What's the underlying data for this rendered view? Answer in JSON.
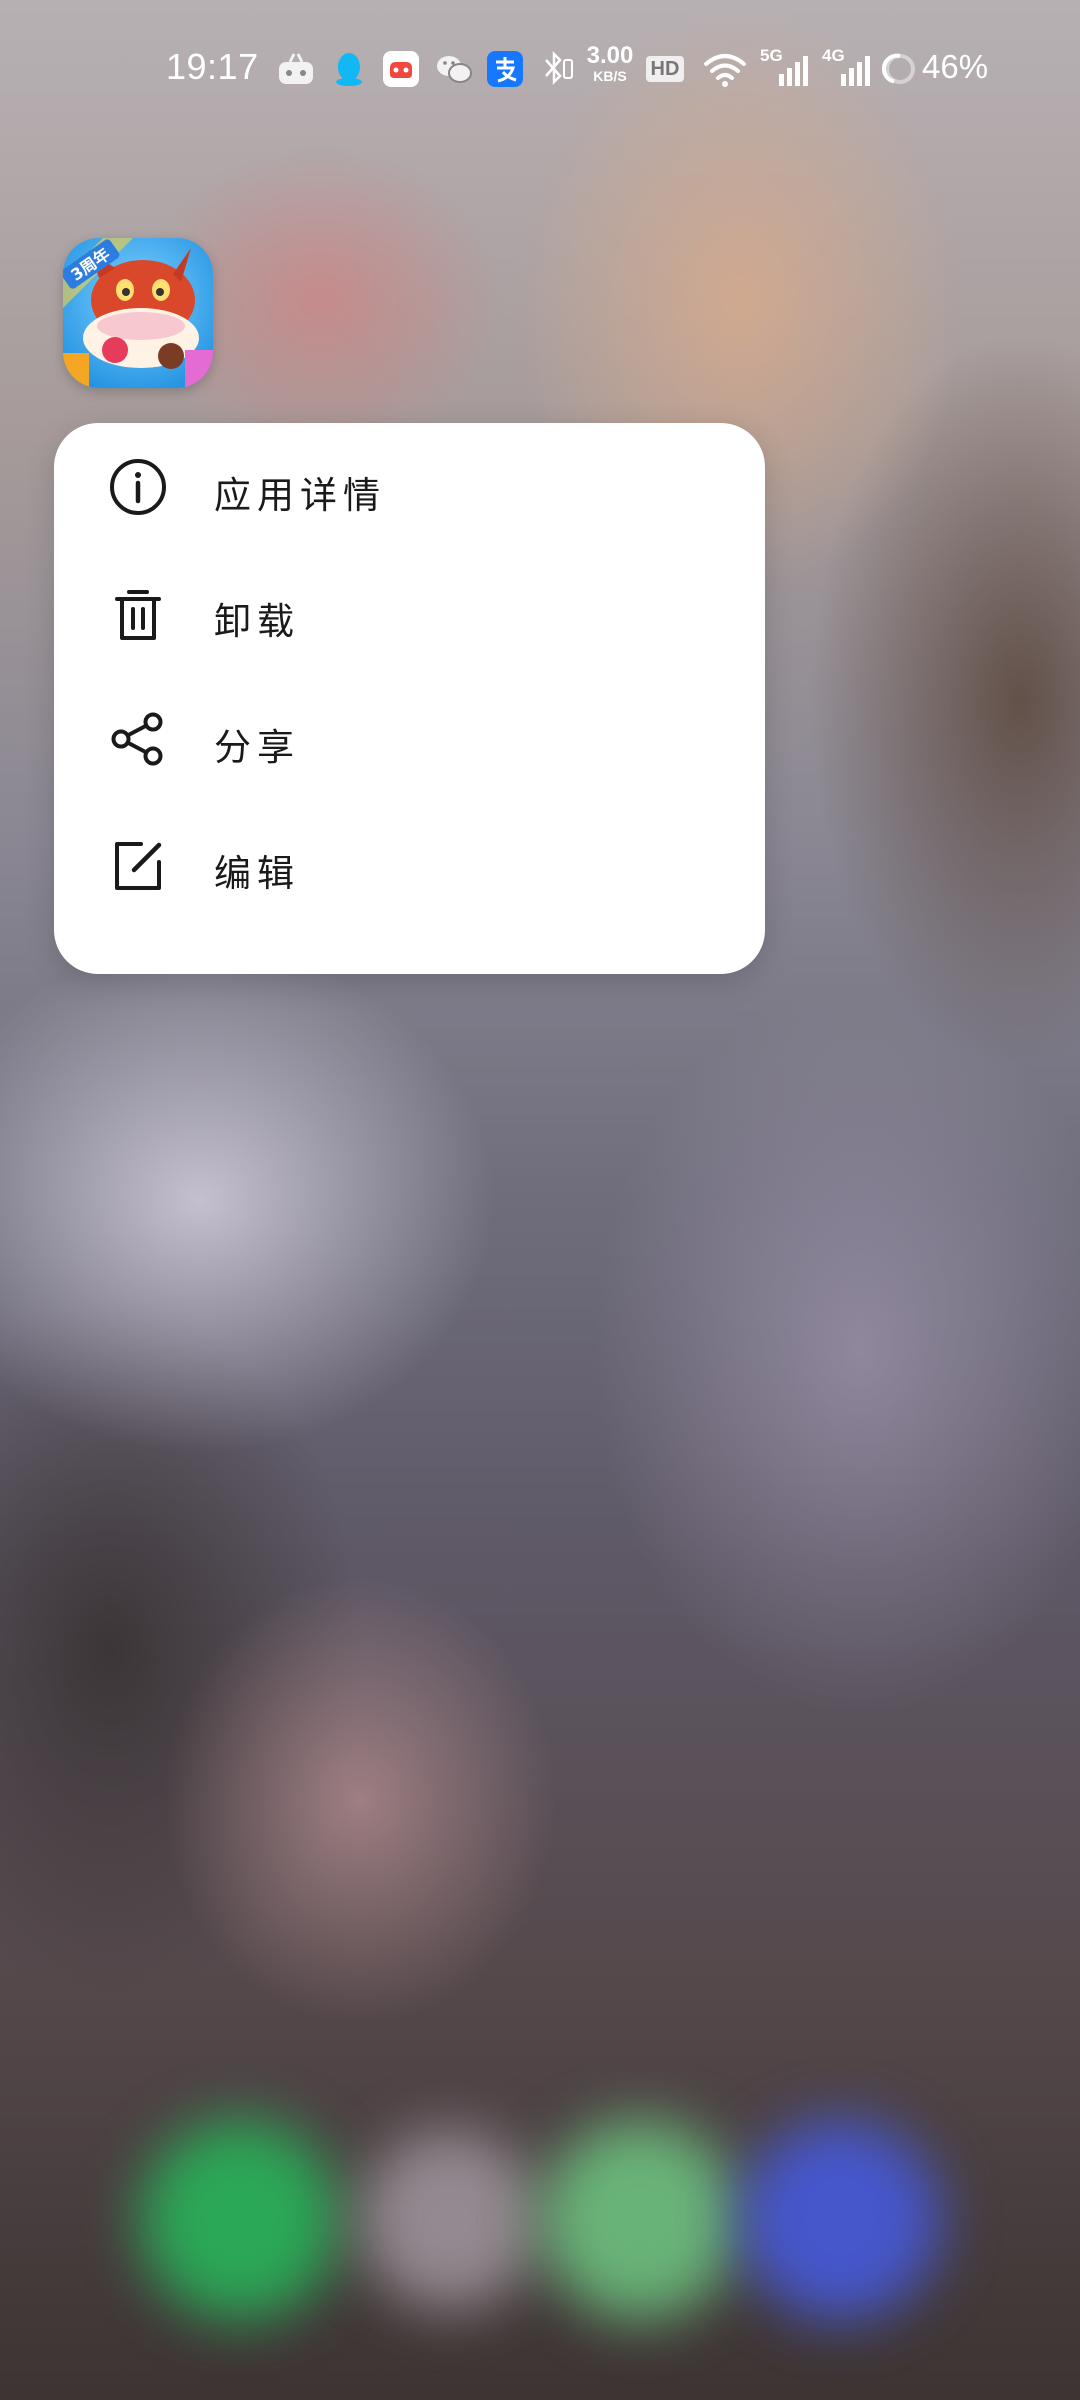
{
  "status_bar": {
    "time": "19:17",
    "net_speed_value": "3.00",
    "net_speed_unit": "KB/S",
    "hd_label": "HD",
    "signal_5g": "5G",
    "signal_4g": "4G",
    "battery": "46%",
    "icons": [
      "game-assistant-icon",
      "qq-icon",
      "game-center-icon",
      "wechat-icon",
      "alipay-icon",
      "bluetooth-icon",
      "hd-icon",
      "wifi-icon",
      "signal-5g-icon",
      "signal-4g-icon",
      "battery-icon"
    ]
  },
  "app": {
    "icon": "game-app-icon",
    "badge": "3周年"
  },
  "menu": {
    "items": [
      {
        "label": "应用详情",
        "icon": "info-icon"
      },
      {
        "label": "卸载",
        "icon": "trash-icon"
      },
      {
        "label": "分享",
        "icon": "share-icon"
      },
      {
        "label": "编辑",
        "icon": "edit-icon"
      }
    ]
  },
  "colors": {
    "menu_background": "#ffffff",
    "menu_text": "#1a1a1a",
    "status_text": "#ffffff"
  }
}
